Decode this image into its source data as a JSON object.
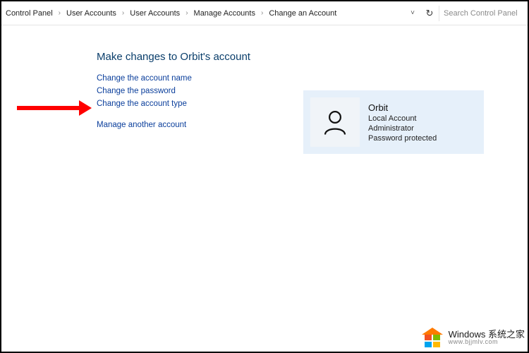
{
  "breadcrumbs": {
    "items": [
      {
        "label": "Control Panel"
      },
      {
        "label": "User Accounts"
      },
      {
        "label": "User Accounts"
      },
      {
        "label": "Manage Accounts"
      },
      {
        "label": "Change an Account"
      }
    ]
  },
  "topbar": {
    "dropdown_glyph": "˅",
    "refresh_glyph": "↻",
    "search_placeholder": "Search Control Panel"
  },
  "page": {
    "heading": "Make changes to Orbit's account",
    "links": {
      "change_name": "Change the account name",
      "change_password": "Change the password",
      "change_type": "Change the account type",
      "manage_another": "Manage another account"
    }
  },
  "account_card": {
    "name": "Orbit",
    "type": "Local Account",
    "role": "Administrator",
    "protection": "Password protected"
  },
  "watermark": {
    "brand": "Windows 系统之家",
    "url": "www.bjjmlv.com"
  }
}
